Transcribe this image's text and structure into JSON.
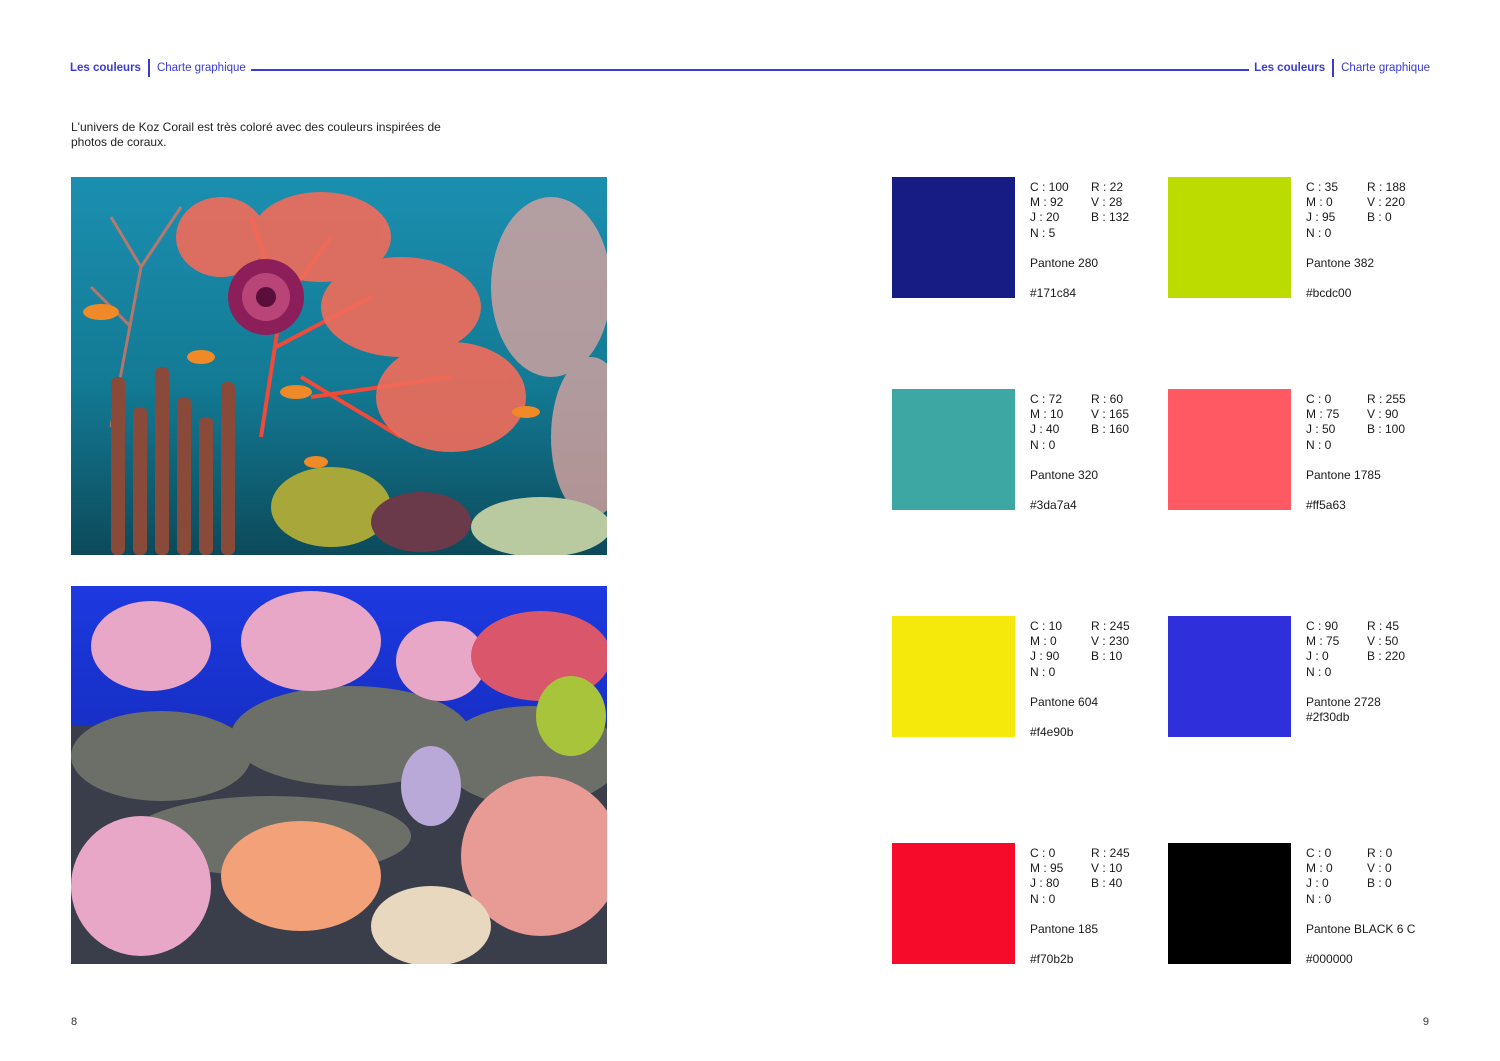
{
  "header": {
    "section": "Les couleurs",
    "subsection": "Charte graphique"
  },
  "intro": "L'univers de Koz Corail est très coloré avec des couleurs inspirées de photos de coraux.",
  "colors": [
    {
      "cmyk": [
        "C : 100",
        "M : 92",
        "J : 20",
        "N : 5"
      ],
      "rgb": [
        "R : 22",
        "V : 28",
        "B : 132"
      ],
      "pantone": "Pantone 280",
      "hex": "#171c84",
      "swatch": "#171c84"
    },
    {
      "cmyk": [
        "C : 35",
        "M : 0",
        "J : 95",
        "N : 0"
      ],
      "rgb": [
        "R : 188",
        "V : 220",
        "B : 0"
      ],
      "pantone": "Pantone 382",
      "hex": "#bcdc00",
      "swatch": "#bcdc00"
    },
    {
      "cmyk": [
        "C : 72",
        "M : 10",
        "J : 40",
        "N : 0"
      ],
      "rgb": [
        "R : 60",
        "V : 165",
        "B : 160"
      ],
      "pantone": "Pantone 320",
      "hex": "#3da7a4",
      "swatch": "#3da7a4"
    },
    {
      "cmyk": [
        "C : 0",
        "M : 75",
        "J : 50",
        "N : 0"
      ],
      "rgb": [
        "R : 255",
        "V : 90",
        "B : 100"
      ],
      "pantone": "Pantone 1785",
      "hex": "#ff5a63",
      "swatch": "#ff5a63"
    },
    {
      "cmyk": [
        "C : 10",
        "M : 0",
        "J : 90",
        "N : 0"
      ],
      "rgb": [
        "R : 245",
        "V : 230",
        "B : 10"
      ],
      "pantone": "Pantone 604",
      "hex": "#f4e90b",
      "swatch": "#f4e90b"
    },
    {
      "cmyk": [
        "C : 90",
        "M : 75",
        "J : 0",
        "N : 0"
      ],
      "rgb": [
        "R : 45",
        "V : 50",
        "B : 220"
      ],
      "pantone": "Pantone 2728",
      "hex": "#2f30db",
      "swatch": "#2f30db"
    },
    {
      "cmyk": [
        "C : 0",
        "M : 95",
        "J : 80",
        "N : 0"
      ],
      "rgb": [
        "R : 245",
        "V : 10",
        "B : 40"
      ],
      "pantone": "Pantone 185",
      "hex": "#f70b2b",
      "swatch": "#f70b2b"
    },
    {
      "cmyk": [
        "C : 0",
        "M : 0",
        "J : 0",
        "N : 0"
      ],
      "rgb": [
        "R : 0",
        "V : 0",
        "B : 0"
      ],
      "pantone": "Pantone BLACK 6 C",
      "hex": "#000000",
      "swatch": "#000000"
    }
  ],
  "page_numbers": {
    "left": "8",
    "right": "9"
  }
}
